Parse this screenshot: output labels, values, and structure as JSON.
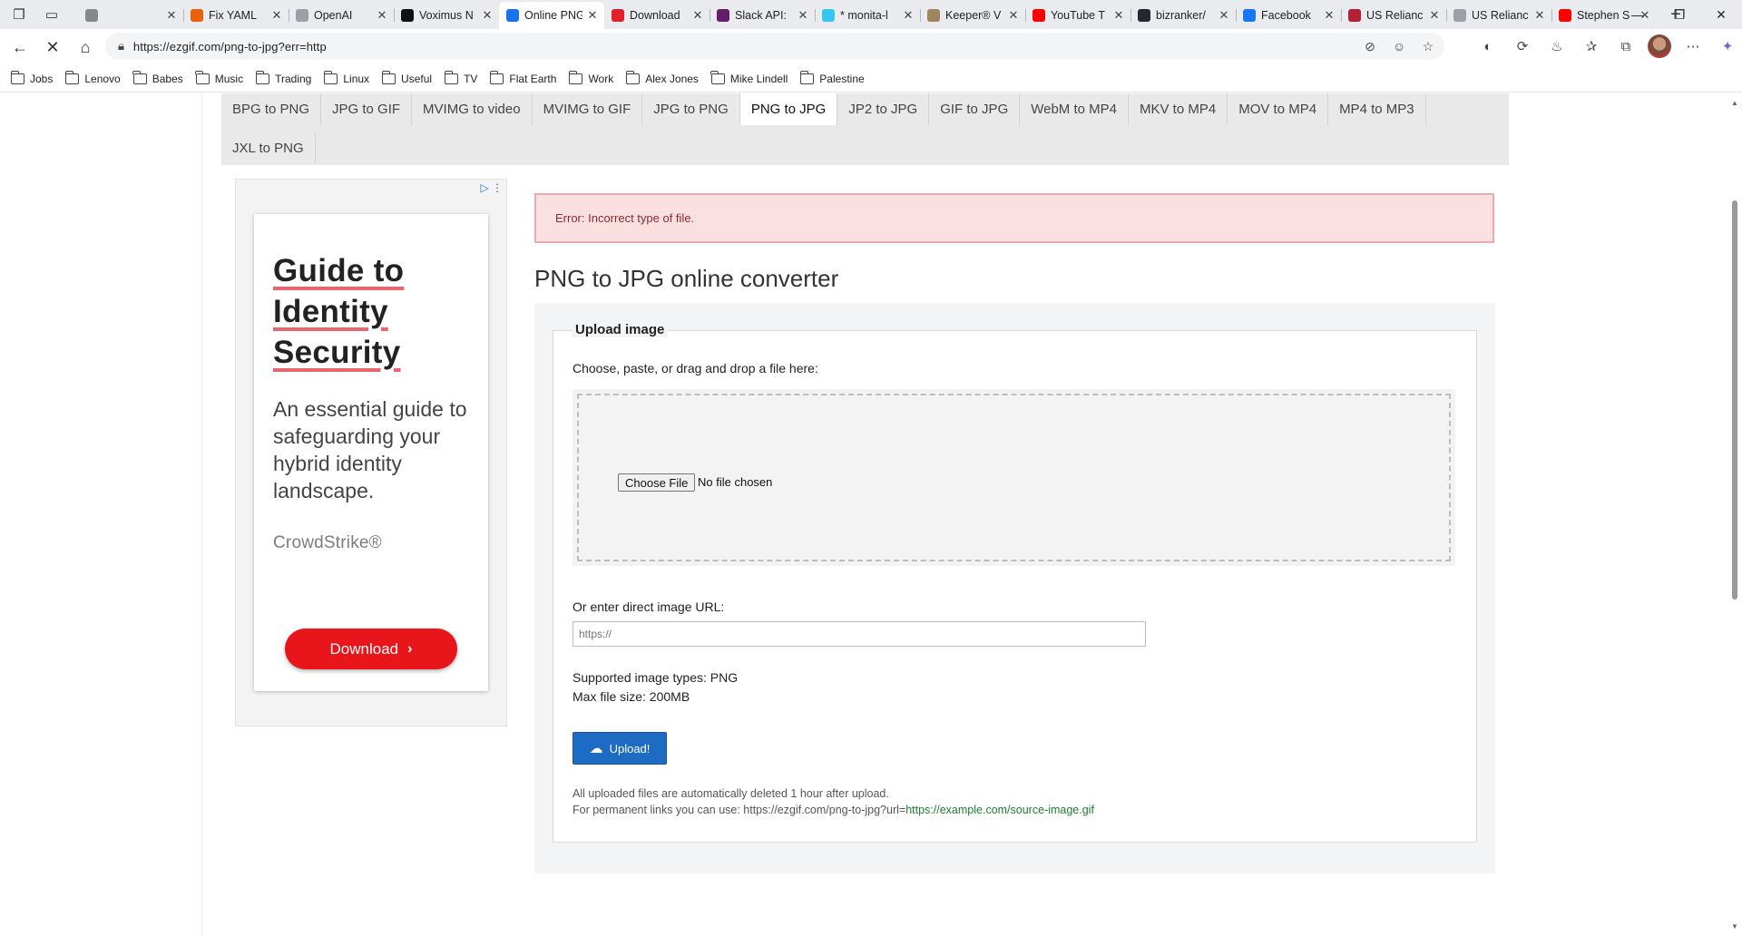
{
  "browser": {
    "tabs": [
      {
        "title": "",
        "favicon_color": "#888888"
      },
      {
        "title": "Fix YAML",
        "favicon_color": "#e8620c"
      },
      {
        "title": "OpenAI",
        "favicon_color": "#9aa0a6"
      },
      {
        "title": "Voximus N",
        "favicon_color": "#111111"
      },
      {
        "title": "Online PNG",
        "favicon_color": "#1a73e8"
      },
      {
        "title": "Download",
        "favicon_color": "#e0202a"
      },
      {
        "title": "Slack API:",
        "favicon_color": "#611f69"
      },
      {
        "title": "* monita-l",
        "favicon_color": "#36c5f0"
      },
      {
        "title": "Keeper® V",
        "favicon_color": "#a0845c"
      },
      {
        "title": "YouTube T",
        "favicon_color": "#ff0000"
      },
      {
        "title": "bizranker/",
        "favicon_color": "#24292f"
      },
      {
        "title": "Facebook",
        "favicon_color": "#1877f2"
      },
      {
        "title": "US Relianc",
        "favicon_color": "#b22234"
      },
      {
        "title": "US Relianc",
        "favicon_color": "#9aa0a6"
      },
      {
        "title": "Stephen S",
        "favicon_color": "#ff0000"
      }
    ],
    "active_tab_index": 4,
    "url": "https://ezgif.com/png-to-jpg?err=http",
    "bookmarks": [
      "Jobs",
      "Lenovo",
      "Babes",
      "Music",
      "Trading",
      "Linux",
      "Useful",
      "TV",
      "Flat Earth",
      "Work",
      "Alex Jones",
      "Mike Lindell",
      "Palestine"
    ]
  },
  "nav": {
    "row1": [
      "BPG to PNG",
      "JPG to GIF",
      "MVIMG to video",
      "MVIMG to GIF",
      "JPG to PNG",
      "PNG to JPG",
      "JP2 to JPG",
      "GIF to JPG",
      "WebM to MP4",
      "MKV to MP4",
      "MOV to MP4",
      "MP4 to MP3"
    ],
    "row2": [
      "JXL to PNG"
    ],
    "active": "PNG to JPG"
  },
  "ad": {
    "headline": [
      "Guide to",
      "Identity",
      "Security"
    ],
    "body": "An essential guide to safeguarding your hybrid identity landscape.",
    "brand": "CrowdStrike®",
    "cta": "Download",
    "cta_color": "#e8151a"
  },
  "main": {
    "error": "Error: Incorrect type of file.",
    "title": "PNG to JPG online converter",
    "legend": "Upload image",
    "choose_label": "Choose, paste, or drag and drop a file here:",
    "choose_file_button": "Choose File",
    "no_file_text": "No file chosen",
    "url_label": "Or enter direct image URL:",
    "url_placeholder": "https://",
    "supported_types": "Supported image types: PNG",
    "max_size": "Max file size: 200MB",
    "upload_button": "Upload!",
    "footnote_line1": "All uploaded files are automatically deleted 1 hour after upload.",
    "footnote_line2_prefix": "For permanent links you can use: https://ezgif.com/png-to-jpg?url=",
    "footnote_link": "https://example.com/source-image.gif"
  }
}
